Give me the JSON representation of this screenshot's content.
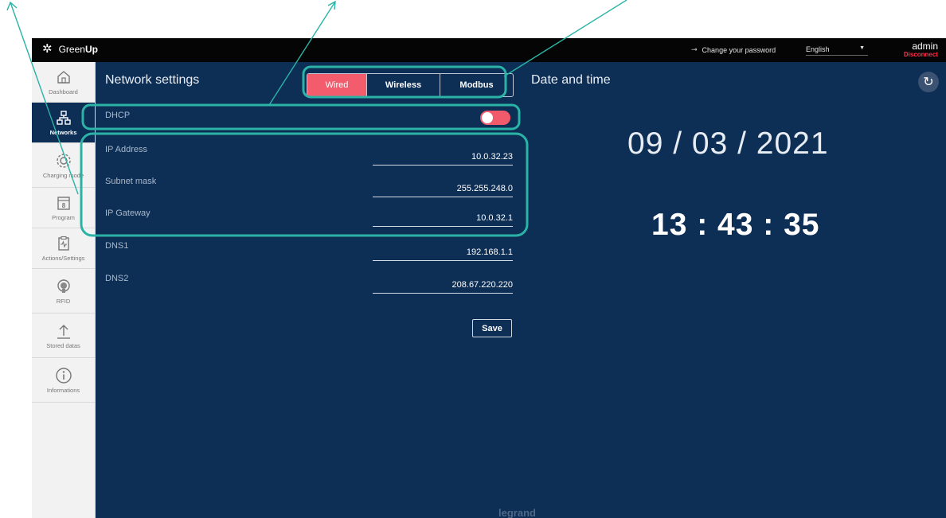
{
  "header": {
    "app_name_prefix": "Green",
    "app_name_bold": "Up",
    "change_password": "Change your password",
    "language": "English",
    "user": "admin",
    "disconnect": "Disconnect"
  },
  "sidebar": {
    "items": [
      {
        "label": "Dashboard",
        "icon": "home-icon"
      },
      {
        "label": "Networks",
        "icon": "network-icon",
        "active": true
      },
      {
        "label": "Charging mode",
        "icon": "gear-icon"
      },
      {
        "label": "Program",
        "icon": "calendar-icon"
      },
      {
        "label": "Actions/Settings",
        "icon": "clipboard-pulse-icon"
      },
      {
        "label": "RFID",
        "icon": "rfid-icon"
      },
      {
        "label": "Stored datas",
        "icon": "upload-icon"
      },
      {
        "label": "Informations",
        "icon": "info-icon"
      }
    ]
  },
  "network": {
    "title": "Network settings",
    "tabs": [
      {
        "label": "Wired",
        "selected": true
      },
      {
        "label": "Wireless"
      },
      {
        "label": "Modbus"
      }
    ],
    "dhcp_label": "DHCP",
    "dhcp_enabled": true,
    "fields": [
      {
        "label": "IP Address",
        "value": "10.0.32.23"
      },
      {
        "label": "Subnet mask",
        "value": "255.255.248.0"
      },
      {
        "label": "IP Gateway",
        "value": "10.0.32.1"
      },
      {
        "label": "DNS1",
        "value": "192.168.1.1"
      },
      {
        "label": "DNS2",
        "value": "208.67.220.220"
      }
    ],
    "save_label": "Save"
  },
  "datetime": {
    "title": "Date and time",
    "date": "09 / 03 / 2021",
    "time": "13 : 43 : 35"
  },
  "footer_brand": "legrand",
  "colors": {
    "background": "#0d2e55",
    "accent": "#f25c6d",
    "callout": "#2ab3a6",
    "topbar": "#050505",
    "sidebar": "#f2f2f2"
  }
}
